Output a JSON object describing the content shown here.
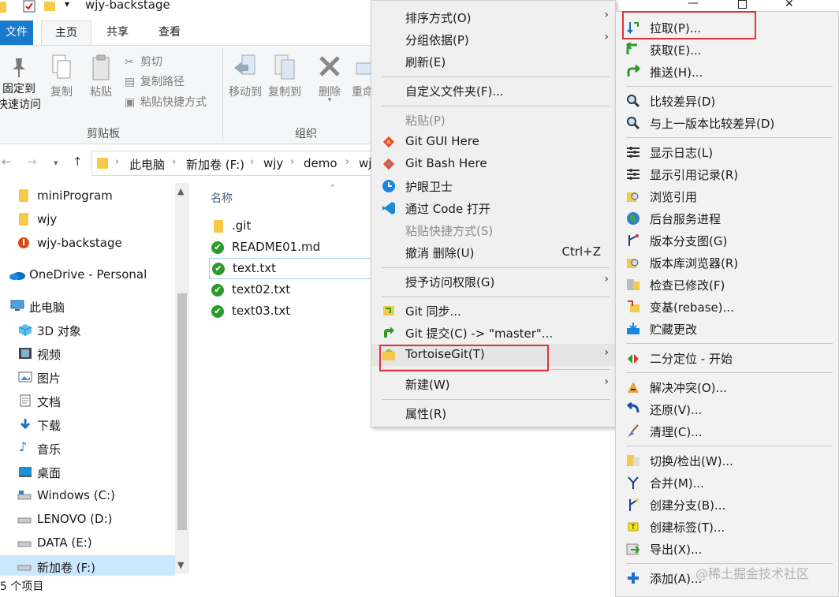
{
  "window": {
    "title": "wjy-backstage",
    "ribbon_tabs": [
      "文件",
      "主页",
      "共享",
      "查看"
    ],
    "clipboard": {
      "pin_label_1": "固定到",
      "pin_label_2": "快速访问",
      "copy": "复制",
      "paste": "粘贴",
      "cut": "剪切",
      "copy_path": "复制路径",
      "paste_shortcut": "粘贴快捷方式",
      "group": "剪贴板"
    },
    "organize": {
      "move_to": "移动到",
      "copy_to": "复制到",
      "delete": "删除",
      "rename": "重命",
      "group": "组织"
    },
    "breadcrumb": [
      "此电脑",
      "新加卷 (F:)",
      "wjy",
      "demo",
      "wj"
    ],
    "nav_items": [
      {
        "label": "miniProgram",
        "icon": "folder-icon"
      },
      {
        "label": "wjy",
        "icon": "folder-icon"
      },
      {
        "label": "wjy-backstage",
        "icon": "git-folder-icon"
      },
      {
        "label": "OneDrive - Personal",
        "icon": "cloud-icon"
      },
      {
        "label": "此电脑",
        "icon": "computer-icon"
      },
      {
        "label": "3D 对象",
        "icon": "cube-icon"
      },
      {
        "label": "视频",
        "icon": "video-icon"
      },
      {
        "label": "图片",
        "icon": "picture-icon"
      },
      {
        "label": "文档",
        "icon": "document-icon"
      },
      {
        "label": "下载",
        "icon": "download-icon"
      },
      {
        "label": "音乐",
        "icon": "music-icon"
      },
      {
        "label": "桌面",
        "icon": "desktop-icon"
      },
      {
        "label": "Windows (C:)",
        "icon": "drive-icon"
      },
      {
        "label": "LENOVO (D:)",
        "icon": "drive-icon"
      },
      {
        "label": "DATA (E:)",
        "icon": "drive-icon"
      },
      {
        "label": "新加卷 (F:)",
        "icon": "drive-icon"
      }
    ],
    "column_name": "名称",
    "files": [
      ".git",
      "README01.md",
      "text.txt",
      "text02.txt",
      "text03.txt"
    ],
    "status": "5 个项目"
  },
  "context_menu": {
    "items": [
      {
        "label": "排序方式(O)",
        "submenu": true
      },
      {
        "label": "分组依据(P)",
        "submenu": true
      },
      {
        "label": "刷新(E)"
      },
      {
        "label": "自定义文件夹(F)..."
      },
      {
        "label": "粘贴(P)",
        "disabled": true
      },
      {
        "label": "Git GUI Here",
        "icon": "git-icon"
      },
      {
        "label": "Git Bash Here",
        "icon": "git-icon"
      },
      {
        "label": "护眼卫士",
        "icon": "eye-guard-icon"
      },
      {
        "label": "通过 Code 打开",
        "icon": "vscode-icon"
      },
      {
        "label": "粘贴快捷方式(S)",
        "disabled": true
      },
      {
        "label": "撤消 删除(U)",
        "shortcut": "Ctrl+Z"
      },
      {
        "label": "授予访问权限(G)",
        "submenu": true
      },
      {
        "label": "Git 同步...",
        "icon": "git-sync-icon"
      },
      {
        "label": "Git 提交(C) -> \"master\"...",
        "icon": "git-commit-icon"
      },
      {
        "label": "TortoiseGit(T)",
        "icon": "tortoisegit-icon",
        "submenu": true
      },
      {
        "label": "新建(W)",
        "submenu": true
      },
      {
        "label": "属性(R)"
      }
    ]
  },
  "tortoise_menu": {
    "items": [
      {
        "label": "拉取(P)...",
        "icon": "pull-icon"
      },
      {
        "label": "获取(E)...",
        "icon": "fetch-icon"
      },
      {
        "label": "推送(H)...",
        "icon": "push-icon"
      },
      {
        "label": "比较差异(D)",
        "icon": "diff-icon"
      },
      {
        "label": "与上一版本比较差异(D)",
        "icon": "diff-previous-icon"
      },
      {
        "label": "显示日志(L)",
        "icon": "log-icon"
      },
      {
        "label": "显示引用记录(R)",
        "icon": "reflog-icon"
      },
      {
        "label": "浏览引用",
        "icon": "browse-refs-icon"
      },
      {
        "label": "后台服务进程",
        "icon": "daemon-icon"
      },
      {
        "label": "版本分支图(G)",
        "icon": "revision-graph-icon"
      },
      {
        "label": "版本库浏览器(R)",
        "icon": "repo-browser-icon"
      },
      {
        "label": "检查已修改(F)",
        "icon": "check-modifications-icon"
      },
      {
        "label": "变基(rebase)...",
        "icon": "rebase-icon"
      },
      {
        "label": "贮藏更改",
        "icon": "stash-icon"
      },
      {
        "label": "二分定位 - 开始",
        "icon": "bisect-icon"
      },
      {
        "label": "解决冲突(O)...",
        "icon": "resolve-icon"
      },
      {
        "label": "还原(V)...",
        "icon": "revert-icon"
      },
      {
        "label": "清理(C)...",
        "icon": "cleanup-icon"
      },
      {
        "label": "切换/检出(W)...",
        "icon": "switch-icon"
      },
      {
        "label": "合并(M)...",
        "icon": "merge-icon"
      },
      {
        "label": "创建分支(B)...",
        "icon": "branch-icon"
      },
      {
        "label": "创建标签(T)...",
        "icon": "tag-icon"
      },
      {
        "label": "导出(X)...",
        "icon": "export-icon"
      },
      {
        "label": "添加(A)...",
        "icon": "add-icon"
      }
    ]
  },
  "watermark": "@稀土掘金技术社区",
  "colors": {
    "accent": "#1979ca",
    "highlight": "#e0343a"
  }
}
